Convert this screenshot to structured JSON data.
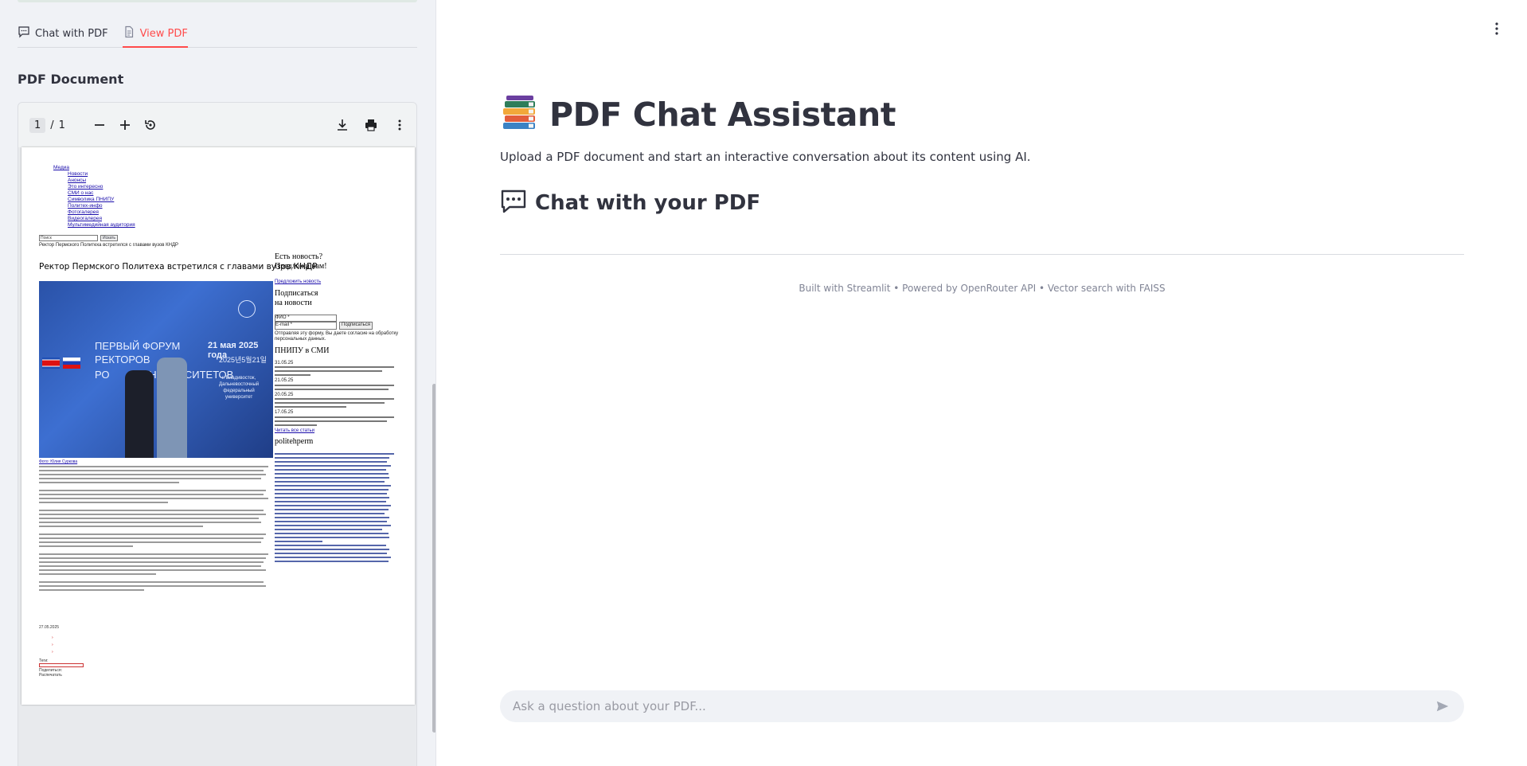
{
  "sidebar": {
    "tabs": [
      {
        "label": "Chat with PDF",
        "icon": "chat-icon"
      },
      {
        "label": "View PDF",
        "icon": "document-icon",
        "active": true
      }
    ],
    "heading": "PDF Document",
    "viewer": {
      "current_page": "1",
      "separator": "/",
      "total_pages": "1",
      "page": {
        "nav_top": "Медиа",
        "nav_items": [
          "Новости",
          "Анонсы",
          "Это интересно",
          "СМИ о нас",
          "Символика ПНИПУ",
          "Политех-инфо",
          "Фотогалерея",
          "Видеогалерея",
          "Мультимедийная аудитория"
        ],
        "search_placeholder": "Поиск",
        "search_button": "Искать",
        "breadcrumb": "Ректор Пермского Политеха встретился с главами вузов КНДР",
        "article_title": "Ректор Пермского Политеха встретился с главами вузов КНДР",
        "photo_text_1": "ПЕРВЫЙ ФОРУМ",
        "photo_text_2": "РЕКТОРОВ",
        "photo_text_3": "РО",
        "photo_text_4": "УНИВЕРСИТЕТОВ",
        "photo_date": "21 мая 2025 года",
        "photo_date_2": "2025년5월21일",
        "photo_city": "г. Владивосток,\nДальневосточный\nфедеральный\nуниверситет",
        "photo_caption": "Фото: Юлия Суркова",
        "right_q1": "Есть новость?",
        "right_q2": "Предложи нам!",
        "right_suggest": "Предложить новость",
        "right_sub1": "Подписаться",
        "right_sub2": "на новости",
        "right_fio": "ФИО *",
        "right_email": "E-mail *",
        "right_subscribe_btn": "Подписаться",
        "right_consent": "Отправляя эту форму, Вы даете согласие на обработку персональных данных.",
        "right_smi": "ПНИПУ в СМИ",
        "right_more": "Читать все статьи",
        "right_politeh": "politehperm",
        "right_date1": "31.05.25",
        "right_date2": "21.05.25",
        "right_date3": "20.05.25",
        "right_date4": "17.05.25",
        "article_date": "27.05.2025",
        "tags_label": "Теги:",
        "share_label": "Поделиться:",
        "print_label": "Распечатать"
      }
    }
  },
  "main": {
    "title": "PDF Chat Assistant",
    "subtitle": "Upload a PDF document and start an interactive conversation about its content using AI.",
    "section_title": "Chat with your PDF",
    "footer": "Built with Streamlit • Powered by OpenRouter API • Vector search with FAISS",
    "chat_placeholder": "Ask a question about your PDF..."
  },
  "colors": {
    "accent": "#ff4b4b",
    "sidebar_bg": "#f0f2f6",
    "text": "#31333f",
    "muted": "#808495"
  }
}
